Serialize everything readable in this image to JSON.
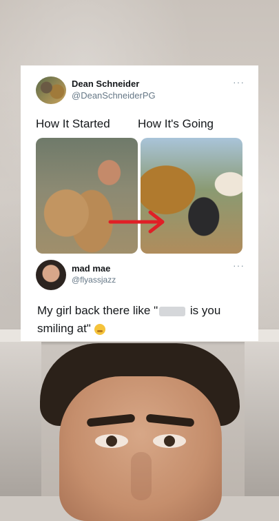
{
  "tweet": {
    "author_name": "Dean Schneider",
    "author_handle": "@DeanSchneiderPG",
    "more_glyph": "···",
    "caption_left": "How It Started",
    "caption_right": "How It's Going"
  },
  "reply": {
    "author_name": "mad mae",
    "author_handle": "@flyassjazz",
    "more_glyph": "···",
    "text_before": "My girl back there like \"",
    "text_after": " is you smiling at\" "
  },
  "icons": {
    "more": "more-icon",
    "emoji": "grimace-emoji-icon",
    "arrow": "red-arrow-icon"
  },
  "colors": {
    "card_bg": "#ffffff",
    "name": "#14171a",
    "handle": "#657786",
    "arrow": "#e01f26"
  }
}
